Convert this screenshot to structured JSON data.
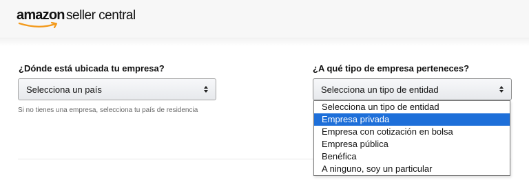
{
  "header": {
    "logo_amazon": "amazon",
    "logo_rest": "seller central"
  },
  "form": {
    "location_label": "¿Dónde está ubicada tu empresa?",
    "country_select_value": "Selecciona un país",
    "hint": "Si no tienes una empresa, selecciona tu país de residencia",
    "entity_label": "¿A qué tipo de empresa perteneces?",
    "entity_select_value": "Selecciona un tipo de entidad",
    "entity_options": [
      "Selecciona un tipo de entidad",
      "Empresa privada",
      "Empresa con cotización en bolsa",
      "Empresa pública",
      "Benéfica",
      "A ninguno, soy un particular"
    ],
    "highlighted_option": "Empresa privada"
  },
  "colors": {
    "highlight": "#1e6fd9",
    "smile": "#f39a1c"
  }
}
